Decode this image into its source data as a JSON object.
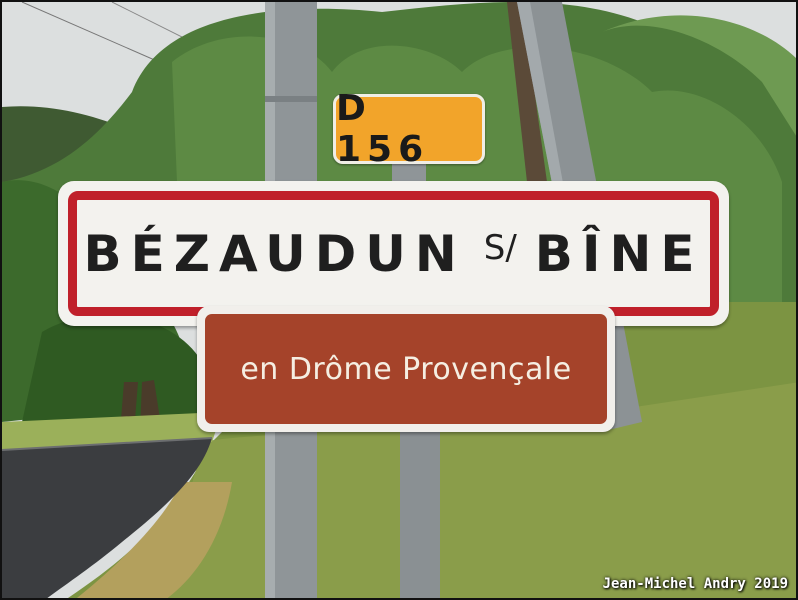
{
  "route_sign": {
    "text": "D 156",
    "color": "#f2a42a"
  },
  "town_sign": {
    "part1": "BÉZAUDUN",
    "separator": "S/",
    "part2": "BÎNE",
    "border_color": "#c0202a"
  },
  "region_sign": {
    "text": "en Drôme Provençale",
    "color": "#a5432a"
  },
  "credit": "Jean-Michel Andry 2019"
}
